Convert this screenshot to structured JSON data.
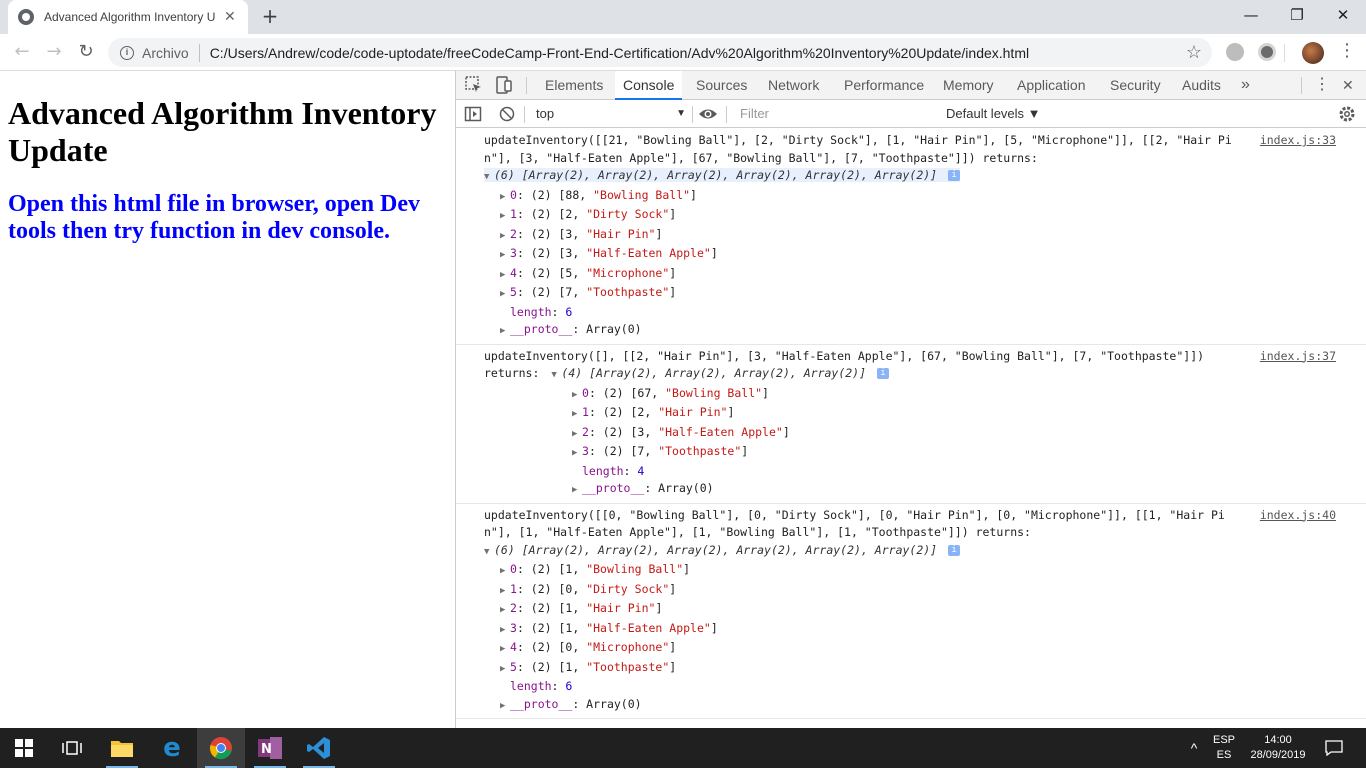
{
  "browser": {
    "tab_title": "Advanced Algorithm Inventory U",
    "new_tab": "+",
    "window_controls": {
      "minimize": "—",
      "restore": "❐",
      "close": "✕"
    },
    "back": "←",
    "forward": "→",
    "reload": "↻",
    "security_label": "Archivo",
    "url": "C:/Users/Andrew/code/code-uptodate/freeCodeCamp-Front-End-Certification/Adv%20Algorithm%20Inventory%20Update/index.html",
    "bookmark": "☆"
  },
  "page": {
    "heading": "Advanced Algorithm Inventory Update",
    "subheading": "Open this html file in browser, open Dev tools then try function in dev console."
  },
  "devtools": {
    "tabs": [
      "Elements",
      "Console",
      "Sources",
      "Network",
      "Performance",
      "Memory",
      "Application",
      "Security",
      "Audits"
    ],
    "active_tab": "Console",
    "more_tabs": "»",
    "menu": "⋮",
    "close": "✕",
    "context": "top",
    "filter_placeholder": "Filter",
    "levels": "Default levels ▼"
  },
  "console": {
    "messages": [
      {
        "source": "index.js:33",
        "text": "updateInventory([[21, \"Bowling Ball\"], [2, \"Dirty Sock\"], [1, \"Hair Pin\"], [5, \"Microphone\"]], [[2, \"Hair Pin\"], [3, \"Half-Eaten Apple\"], [67, \"Bowling Ball\"], [7, \"Toothpaste\"]]) returns:",
        "summary": "(6) [Array(2), Array(2), Array(2), Array(2), Array(2), Array(2)]",
        "items": [
          [
            "0",
            "(2) [88, ",
            "\"Bowling Ball\"",
            "]"
          ],
          [
            "1",
            "(2) [2, ",
            "\"Dirty Sock\"",
            "]"
          ],
          [
            "2",
            "(2) [3, ",
            "\"Hair Pin\"",
            "]"
          ],
          [
            "3",
            "(2) [3, ",
            "\"Half-Eaten Apple\"",
            "]"
          ],
          [
            "4",
            "(2) [5, ",
            "\"Microphone\"",
            "]"
          ],
          [
            "5",
            "(2) [7, ",
            "\"Toothpaste\"",
            "]"
          ]
        ],
        "length": "6",
        "proto": "Array(0)"
      },
      {
        "source": "index.js:37",
        "text": "updateInventory([], [[2, \"Hair Pin\"], [3, \"Half-Eaten Apple\"], [67, \"Bowling Ball\"], [7, \"Toothpaste\"]])",
        "returns_label": "returns:",
        "summary": "(4) [Array(2), Array(2), Array(2), Array(2)]",
        "items": [
          [
            "0",
            "(2) [67, ",
            "\"Bowling Ball\"",
            "]"
          ],
          [
            "1",
            "(2) [2, ",
            "\"Hair Pin\"",
            "]"
          ],
          [
            "2",
            "(2) [3, ",
            "\"Half-Eaten Apple\"",
            "]"
          ],
          [
            "3",
            "(2) [7, ",
            "\"Toothpaste\"",
            "]"
          ]
        ],
        "length": "4",
        "proto": "Array(0)"
      },
      {
        "source": "index.js:40",
        "text": "updateInventory([[0, \"Bowling Ball\"], [0, \"Dirty Sock\"], [0, \"Hair Pin\"], [0, \"Microphone\"]], [[1, \"Hair Pin\"], [1, \"Half-Eaten Apple\"], [1, \"Bowling Ball\"], [1, \"Toothpaste\"]]) returns:",
        "summary": "(6) [Array(2), Array(2), Array(2), Array(2), Array(2), Array(2)]",
        "items": [
          [
            "0",
            "(2) [1, ",
            "\"Bowling Ball\"",
            "]"
          ],
          [
            "1",
            "(2) [0, ",
            "\"Dirty Sock\"",
            "]"
          ],
          [
            "2",
            "(2) [1, ",
            "\"Hair Pin\"",
            "]"
          ],
          [
            "3",
            "(2) [1, ",
            "\"Half-Eaten Apple\"",
            "]"
          ],
          [
            "4",
            "(2) [0, ",
            "\"Microphone\"",
            "]"
          ],
          [
            "5",
            "(2) [1, ",
            "\"Toothpaste\"",
            "]"
          ]
        ],
        "length": "6",
        "proto": "Array(0)"
      }
    ],
    "prompt": "›"
  },
  "taskbar": {
    "lang_top": "ESP",
    "lang_bottom": "ES",
    "time": "14:00",
    "date": "28/09/2019",
    "chevron": "^",
    "notification": "▭"
  },
  "colors": {
    "accent": "#1a73e8",
    "page_subheading": "#0000ff",
    "taskbar": "#202020"
  }
}
